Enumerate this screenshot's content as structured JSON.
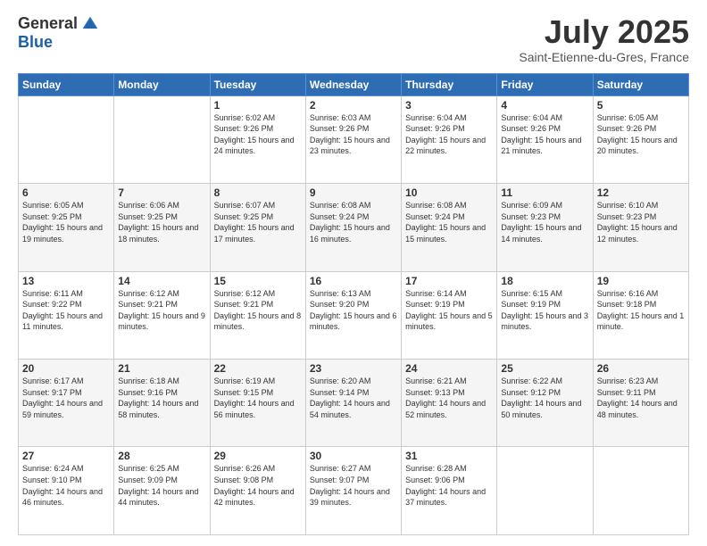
{
  "logo": {
    "general": "General",
    "blue": "Blue"
  },
  "title": "July 2025",
  "subtitle": "Saint-Etienne-du-Gres, France",
  "days_of_week": [
    "Sunday",
    "Monday",
    "Tuesday",
    "Wednesday",
    "Thursday",
    "Friday",
    "Saturday"
  ],
  "weeks": [
    [
      {
        "day": "",
        "info": ""
      },
      {
        "day": "",
        "info": ""
      },
      {
        "day": "1",
        "info": "Sunrise: 6:02 AM\nSunset: 9:26 PM\nDaylight: 15 hours and 24 minutes."
      },
      {
        "day": "2",
        "info": "Sunrise: 6:03 AM\nSunset: 9:26 PM\nDaylight: 15 hours and 23 minutes."
      },
      {
        "day": "3",
        "info": "Sunrise: 6:04 AM\nSunset: 9:26 PM\nDaylight: 15 hours and 22 minutes."
      },
      {
        "day": "4",
        "info": "Sunrise: 6:04 AM\nSunset: 9:26 PM\nDaylight: 15 hours and 21 minutes."
      },
      {
        "day": "5",
        "info": "Sunrise: 6:05 AM\nSunset: 9:26 PM\nDaylight: 15 hours and 20 minutes."
      }
    ],
    [
      {
        "day": "6",
        "info": "Sunrise: 6:05 AM\nSunset: 9:25 PM\nDaylight: 15 hours and 19 minutes."
      },
      {
        "day": "7",
        "info": "Sunrise: 6:06 AM\nSunset: 9:25 PM\nDaylight: 15 hours and 18 minutes."
      },
      {
        "day": "8",
        "info": "Sunrise: 6:07 AM\nSunset: 9:25 PM\nDaylight: 15 hours and 17 minutes."
      },
      {
        "day": "9",
        "info": "Sunrise: 6:08 AM\nSunset: 9:24 PM\nDaylight: 15 hours and 16 minutes."
      },
      {
        "day": "10",
        "info": "Sunrise: 6:08 AM\nSunset: 9:24 PM\nDaylight: 15 hours and 15 minutes."
      },
      {
        "day": "11",
        "info": "Sunrise: 6:09 AM\nSunset: 9:23 PM\nDaylight: 15 hours and 14 minutes."
      },
      {
        "day": "12",
        "info": "Sunrise: 6:10 AM\nSunset: 9:23 PM\nDaylight: 15 hours and 12 minutes."
      }
    ],
    [
      {
        "day": "13",
        "info": "Sunrise: 6:11 AM\nSunset: 9:22 PM\nDaylight: 15 hours and 11 minutes."
      },
      {
        "day": "14",
        "info": "Sunrise: 6:12 AM\nSunset: 9:21 PM\nDaylight: 15 hours and 9 minutes."
      },
      {
        "day": "15",
        "info": "Sunrise: 6:12 AM\nSunset: 9:21 PM\nDaylight: 15 hours and 8 minutes."
      },
      {
        "day": "16",
        "info": "Sunrise: 6:13 AM\nSunset: 9:20 PM\nDaylight: 15 hours and 6 minutes."
      },
      {
        "day": "17",
        "info": "Sunrise: 6:14 AM\nSunset: 9:19 PM\nDaylight: 15 hours and 5 minutes."
      },
      {
        "day": "18",
        "info": "Sunrise: 6:15 AM\nSunset: 9:19 PM\nDaylight: 15 hours and 3 minutes."
      },
      {
        "day": "19",
        "info": "Sunrise: 6:16 AM\nSunset: 9:18 PM\nDaylight: 15 hours and 1 minute."
      }
    ],
    [
      {
        "day": "20",
        "info": "Sunrise: 6:17 AM\nSunset: 9:17 PM\nDaylight: 14 hours and 59 minutes."
      },
      {
        "day": "21",
        "info": "Sunrise: 6:18 AM\nSunset: 9:16 PM\nDaylight: 14 hours and 58 minutes."
      },
      {
        "day": "22",
        "info": "Sunrise: 6:19 AM\nSunset: 9:15 PM\nDaylight: 14 hours and 56 minutes."
      },
      {
        "day": "23",
        "info": "Sunrise: 6:20 AM\nSunset: 9:14 PM\nDaylight: 14 hours and 54 minutes."
      },
      {
        "day": "24",
        "info": "Sunrise: 6:21 AM\nSunset: 9:13 PM\nDaylight: 14 hours and 52 minutes."
      },
      {
        "day": "25",
        "info": "Sunrise: 6:22 AM\nSunset: 9:12 PM\nDaylight: 14 hours and 50 minutes."
      },
      {
        "day": "26",
        "info": "Sunrise: 6:23 AM\nSunset: 9:11 PM\nDaylight: 14 hours and 48 minutes."
      }
    ],
    [
      {
        "day": "27",
        "info": "Sunrise: 6:24 AM\nSunset: 9:10 PM\nDaylight: 14 hours and 46 minutes."
      },
      {
        "day": "28",
        "info": "Sunrise: 6:25 AM\nSunset: 9:09 PM\nDaylight: 14 hours and 44 minutes."
      },
      {
        "day": "29",
        "info": "Sunrise: 6:26 AM\nSunset: 9:08 PM\nDaylight: 14 hours and 42 minutes."
      },
      {
        "day": "30",
        "info": "Sunrise: 6:27 AM\nSunset: 9:07 PM\nDaylight: 14 hours and 39 minutes."
      },
      {
        "day": "31",
        "info": "Sunrise: 6:28 AM\nSunset: 9:06 PM\nDaylight: 14 hours and 37 minutes."
      },
      {
        "day": "",
        "info": ""
      },
      {
        "day": "",
        "info": ""
      }
    ]
  ]
}
